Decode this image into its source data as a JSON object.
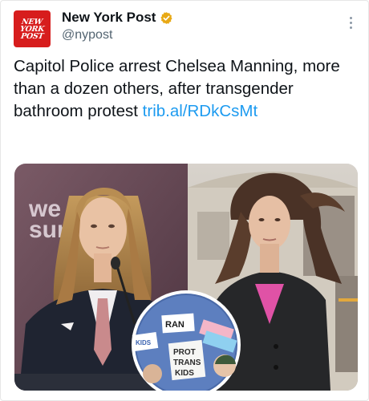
{
  "account": {
    "name": "New York Post",
    "handle": "@nypost",
    "logo_lines": [
      "NEW",
      "YORK",
      "POST"
    ],
    "verified": true
  },
  "tweet": {
    "text": "Capitol Police arrest Chelsea Manning, more than a dozen others, after transgender bathroom protest ",
    "link": "trib.al/RDkCsMt"
  },
  "media": {
    "backdrop_text": [
      "we",
      "sun"
    ],
    "sign_texts": [
      "RAN",
      "KIDS",
      "PROT",
      "TRANS",
      "KIDS"
    ]
  },
  "icons": {
    "verified": "verified-badge-icon",
    "more": "more-options-icon"
  },
  "colors": {
    "link": "#1d9bf0",
    "logo_red": "#d71d1d",
    "verified_gold": "#e8a915",
    "text": "#0f1419",
    "muted": "#536471"
  }
}
